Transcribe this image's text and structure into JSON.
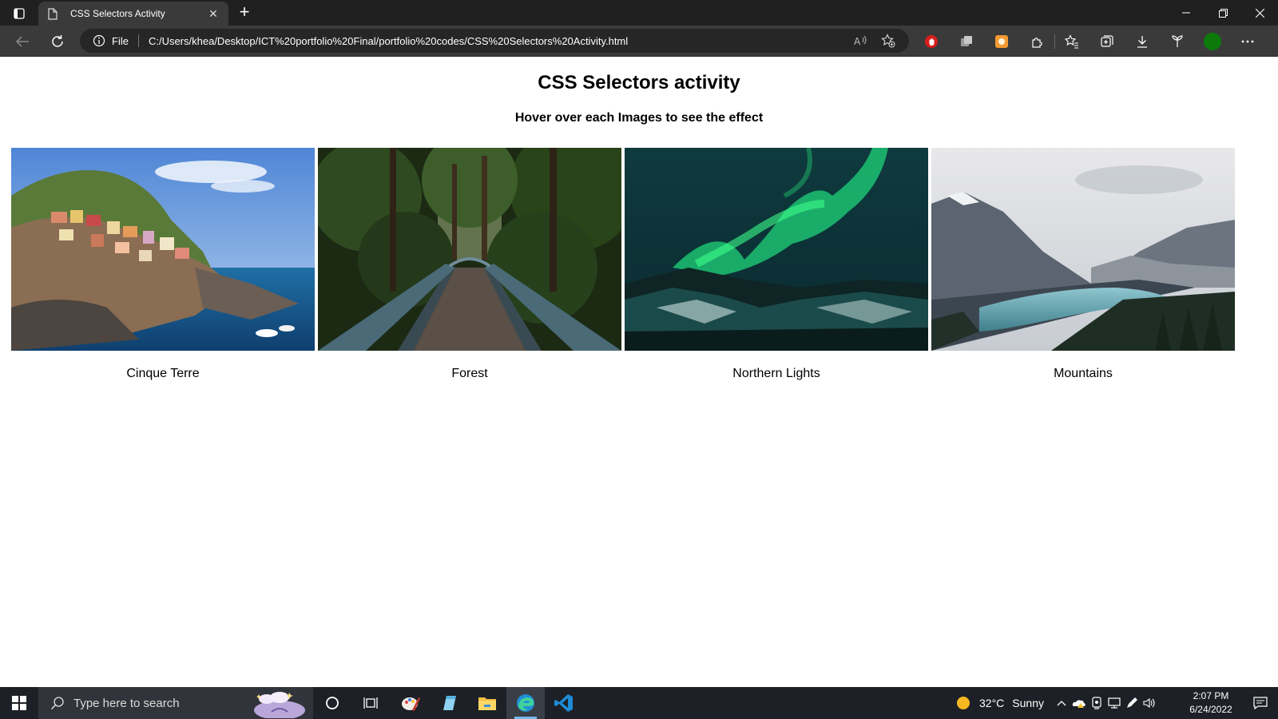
{
  "browser": {
    "tab_title": "CSS Selectors Activity",
    "address_scheme": "File",
    "address_url": "C:/Users/khea/Desktop/ICT%20portfolio%20Final/portfolio%20codes/CSS%20Selectors%20Activity.html"
  },
  "page": {
    "title": "CSS Selectors activity",
    "subtitle": "Hover over each Images to see the effect",
    "images": [
      {
        "caption": "Cinque Terre"
      },
      {
        "caption": "Forest"
      },
      {
        "caption": "Northern Lights"
      },
      {
        "caption": "Mountains"
      }
    ]
  },
  "taskbar": {
    "search_placeholder": "Type here to search",
    "weather_temp": "32°C",
    "weather_desc": "Sunny",
    "time": "2:07 PM",
    "date": "6/24/2022"
  },
  "colors": {
    "titlebar": "#202020",
    "toolbar": "#3a3a3a",
    "taskbar": "#1d2026",
    "profile": "#0b7a0b"
  }
}
